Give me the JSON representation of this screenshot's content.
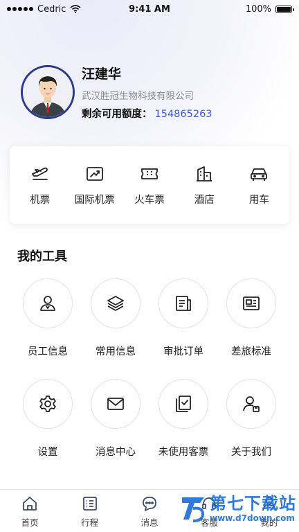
{
  "status_bar": {
    "carrier": "Cedric",
    "time": "9:41 AM",
    "battery": "100%"
  },
  "profile": {
    "name": "汪建华",
    "company": "武汉胜冠生物科技有限公司",
    "credit_label": "剩余可用额度：",
    "credit_value": "154865263"
  },
  "services": [
    {
      "label": "机票",
      "icon": "plane-icon"
    },
    {
      "label": "国际机票",
      "icon": "international-flight-icon"
    },
    {
      "label": "火车票",
      "icon": "train-ticket-icon"
    },
    {
      "label": "酒店",
      "icon": "hotel-icon"
    },
    {
      "label": "用车",
      "icon": "car-icon"
    }
  ],
  "tools": {
    "title": "我的工具",
    "items": [
      {
        "label": "员工信息",
        "icon": "user-icon"
      },
      {
        "label": "常用信息",
        "icon": "layers-icon"
      },
      {
        "label": "审批订单",
        "icon": "document-icon"
      },
      {
        "label": "差旅标准",
        "icon": "id-card-icon"
      },
      {
        "label": "设置",
        "icon": "gear-icon"
      },
      {
        "label": "消息中心",
        "icon": "mail-icon"
      },
      {
        "label": "未使用客票",
        "icon": "ticket-check-icon"
      },
      {
        "label": "关于我们",
        "icon": "user-badge-icon"
      }
    ]
  },
  "tabbar": {
    "items": [
      {
        "label": "首页",
        "icon": "home-icon"
      },
      {
        "label": "行程",
        "icon": "list-icon"
      },
      {
        "label": "消息",
        "icon": "chat-icon"
      },
      {
        "label": "客服",
        "icon": "headset-icon"
      },
      {
        "label": "我的",
        "icon": "profile-icon"
      }
    ]
  },
  "watermark": {
    "main": "第七下载站",
    "url": "www.d7down.com"
  },
  "colors": {
    "accent": "#3b5bd6",
    "avatar_border": "#2b3a8f",
    "watermark": "#1f6fd6"
  }
}
